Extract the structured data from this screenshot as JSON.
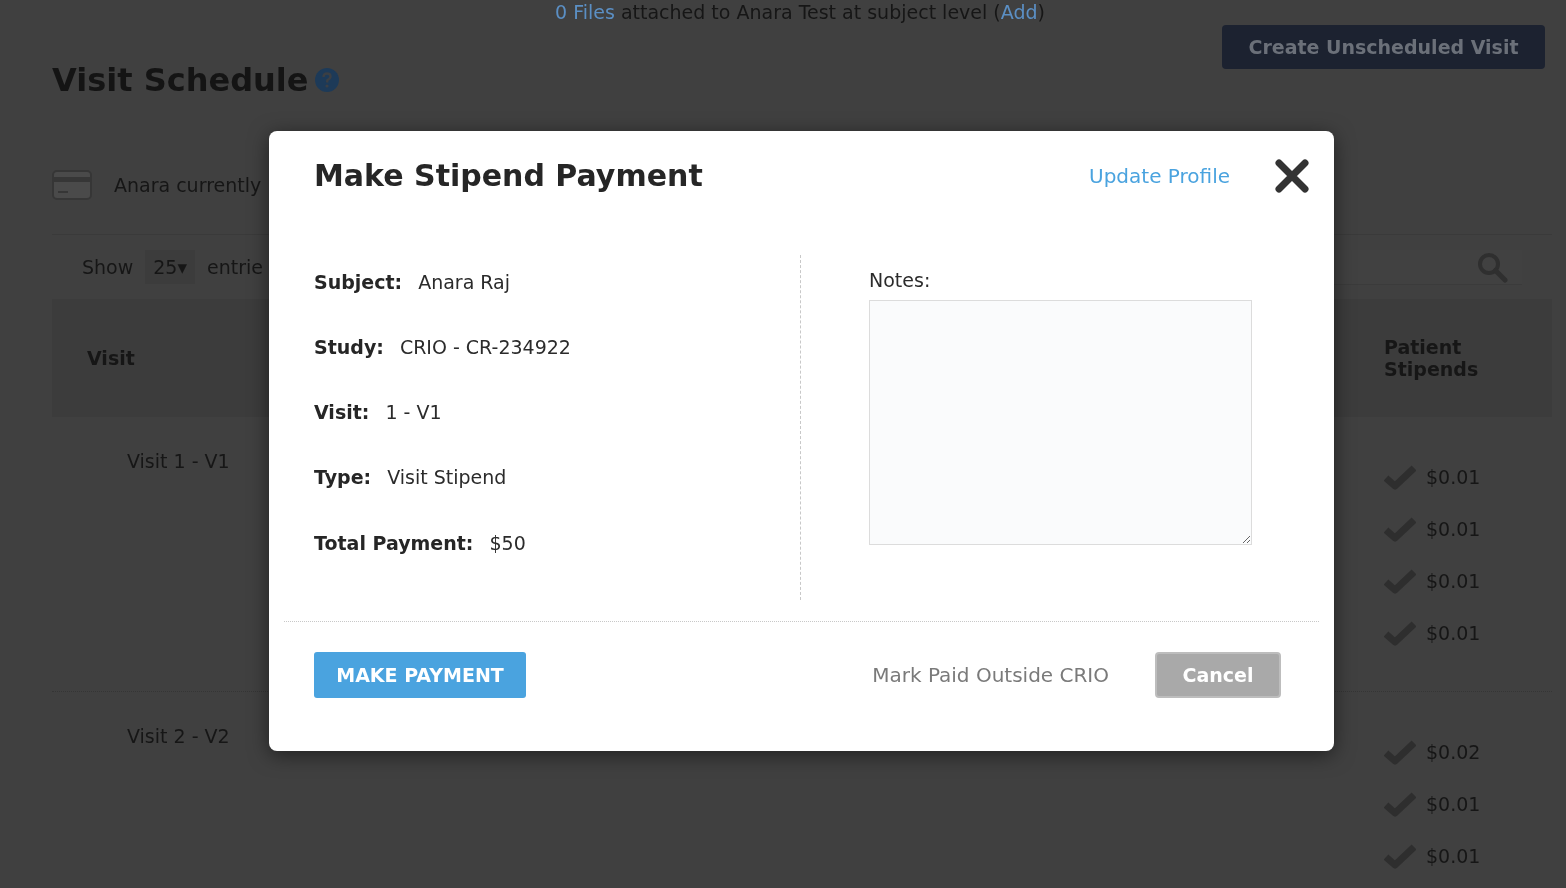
{
  "page": {
    "notice": [
      {
        "kind": "link",
        "text": "0 Files"
      },
      {
        "kind": "text",
        "text": "attached to Anara Test at subject level ("
      },
      {
        "kind": "link",
        "text": "Add"
      },
      {
        "kind": "text",
        "text": ")"
      }
    ],
    "create_button": "Create Unscheduled Visit",
    "title": "Visit Schedule",
    "card_text": "Anara currently",
    "table": {
      "show_label": "Show",
      "page_size": "25▾",
      "entries_label": "entrie",
      "columns": [
        "Visit",
        "Patient Stipends"
      ],
      "rows": [
        {
          "visit": "Visit 1 - V1",
          "stipends": [
            "$0.01",
            "$0.01",
            "$0.01",
            "$0.01"
          ]
        },
        {
          "visit": "Visit 2 - V2",
          "stipends": [
            "$0.02",
            "$0.01",
            "$0.01"
          ]
        }
      ]
    }
  },
  "modal": {
    "title": "Make Stipend Payment",
    "update_link": "Update Profile",
    "fields": [
      {
        "label": "Subject:",
        "value": "Anara Raj"
      },
      {
        "label": "Study:",
        "value": "CRIO - CR-234922"
      },
      {
        "label": "Visit:",
        "value": "1 - V1"
      },
      {
        "label": "Type:",
        "value": "Visit Stipend"
      }
    ],
    "total": {
      "label": "Total Payment:",
      "value": "$50"
    },
    "notes_label": "Notes:",
    "buttons": {
      "primary": "MAKE PAYMENT",
      "outside": "Mark Paid Outside CRIO",
      "cancel": "Cancel"
    }
  }
}
